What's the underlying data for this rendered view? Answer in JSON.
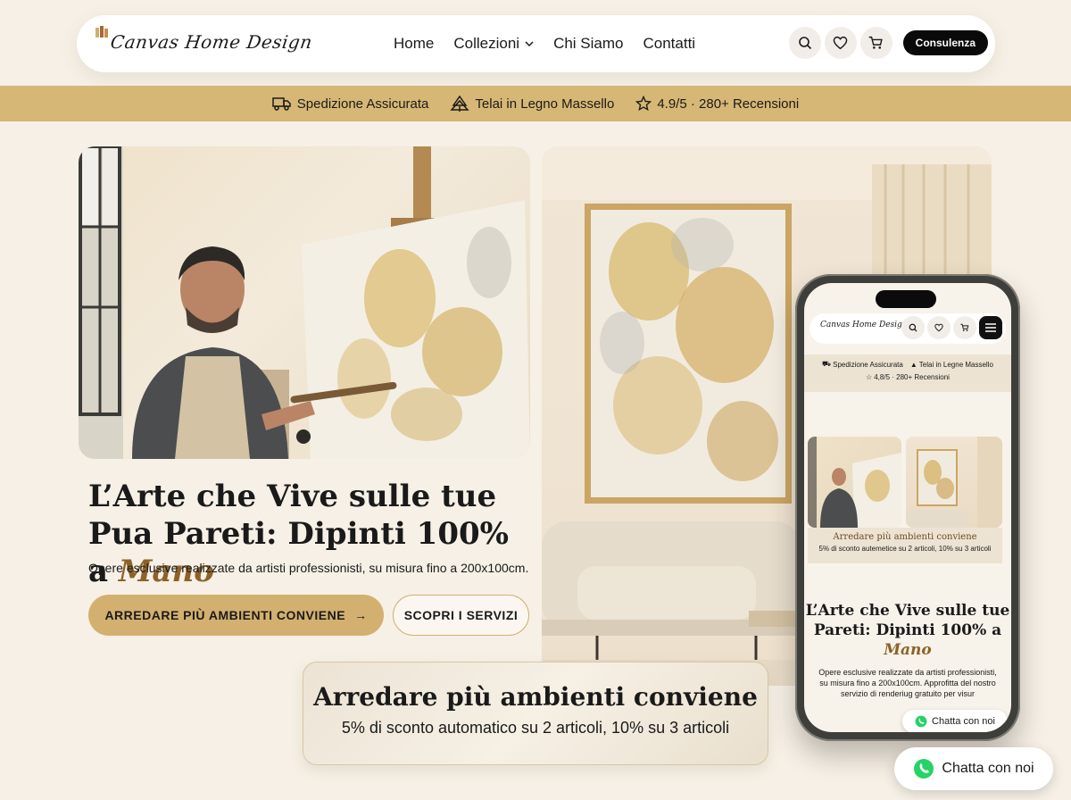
{
  "brand": {
    "name": "Canvas Home Design",
    "accent_gold": "#d3b06f",
    "accent_brown": "#8b6228",
    "background": "#f6f0e6"
  },
  "header": {
    "nav": [
      {
        "label": "Home"
      },
      {
        "label": "Collezioni",
        "has_dropdown": true
      },
      {
        "label": "Chi Siamo"
      },
      {
        "label": "Contatti"
      }
    ],
    "icons": [
      "search-icon",
      "heart-icon",
      "cart-icon"
    ],
    "cta_label": "Consulenza"
  },
  "trust_bar": {
    "items": [
      {
        "icon": "truck-icon",
        "label": "Spedizione Assicurata"
      },
      {
        "icon": "trees-icon",
        "label": "Telai in Legno Massello"
      },
      {
        "icon": "star-icon",
        "label": "4.9/5 · 280+ Recensioni"
      }
    ]
  },
  "hero": {
    "title_main": "L’Arte che Vive sulle tue Pua Pareti: Dipinti 100% a ",
    "title_accent": "Mano",
    "subtitle": "Opere esclusive realizzate da artisti professionisti, su misura fino a 200x100cm.",
    "primary_button": "ARREDARE PIÙ AMBIENTI CONVIENE",
    "primary_button_arrow": "→",
    "secondary_button": "SCOPRI I SERVIZI"
  },
  "promo": {
    "title": "Arredare più ambienti conviene",
    "subtitle": "5% di sconto automatico su 2 articoli, 10% su 3 articoli"
  },
  "mobile": {
    "trust_row1_a": "Spedizione Assicurata",
    "trust_row1_b": "Telai in Legne Massello",
    "trust_row2": "4,8/5 · 280+ Recensioni",
    "promo_title": "Arredare più ambienti conviene",
    "promo_sub": "5% di sconto autemetice su 2 articoli, 10% su 3 articoli",
    "title_main": "L’Arte che Vive sulle tue Pareti: Dipinti 100% a ",
    "title_accent": "Mano",
    "body": "Opere esclusive realizzate da artisti professionisti, su misura fino a 200x100cm. Approfitta del nostro servizio di renderiug gratuito per visur",
    "chat_label": "Chatta con noi"
  },
  "chat": {
    "label": "Chatta con noi",
    "icon": "whatsapp-icon",
    "icon_color": "#25d366"
  }
}
